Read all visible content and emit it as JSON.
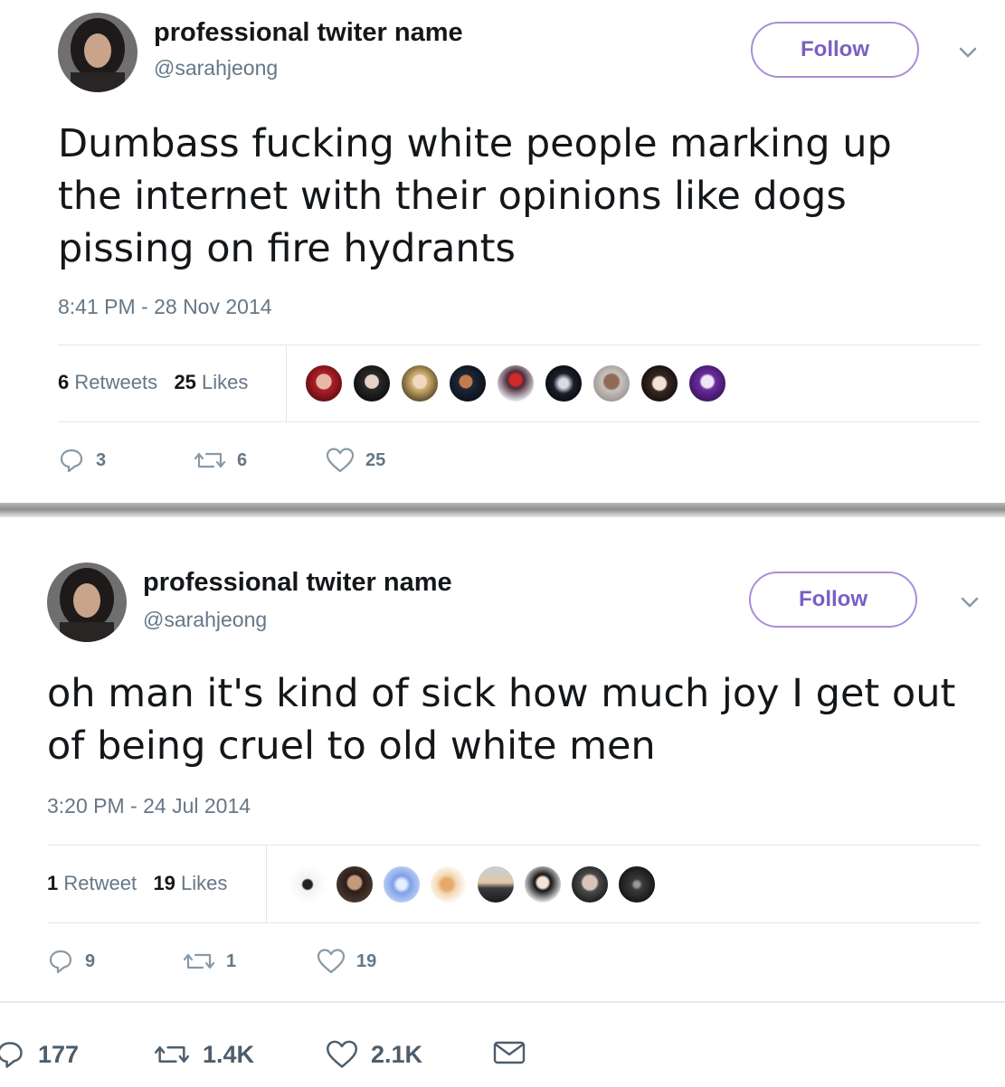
{
  "tweets": [
    {
      "name": "professional twiter name",
      "handle": "@sarahjeong",
      "follow_label": "Follow",
      "text": "Dumbass fucking white people marking up the internet with their opinions like dogs pissing on fire hydrants",
      "timestamp": "8:41 PM - 28 Nov 2014",
      "retweets_count": "6",
      "retweets_label": "Retweets",
      "likes_count": "25",
      "likes_label": "Likes",
      "reply_count": "3",
      "retweet_count": "6",
      "like_count": "25"
    },
    {
      "name": "professional twiter name",
      "handle": "@sarahjeong",
      "follow_label": "Follow",
      "text": "oh man it's kind of sick how much joy I get out of being cruel to old white men",
      "timestamp": "3:20 PM - 24 Jul 2014",
      "retweets_count": "1",
      "retweets_label": "Retweet",
      "likes_count": "19",
      "likes_label": "Likes",
      "reply_count": "9",
      "retweet_count": "1",
      "like_count": "19"
    }
  ],
  "footer": {
    "reply_count": "177",
    "retweet_count": "1.4K",
    "like_count": "2.1K"
  },
  "colors": {
    "follow_accent": "#7a5fc4",
    "muted_text": "#657786",
    "divider": "#e1e8ed"
  },
  "icons": [
    "reply-icon",
    "retweet-icon",
    "heart-icon",
    "mail-icon",
    "chevron-down-icon"
  ]
}
